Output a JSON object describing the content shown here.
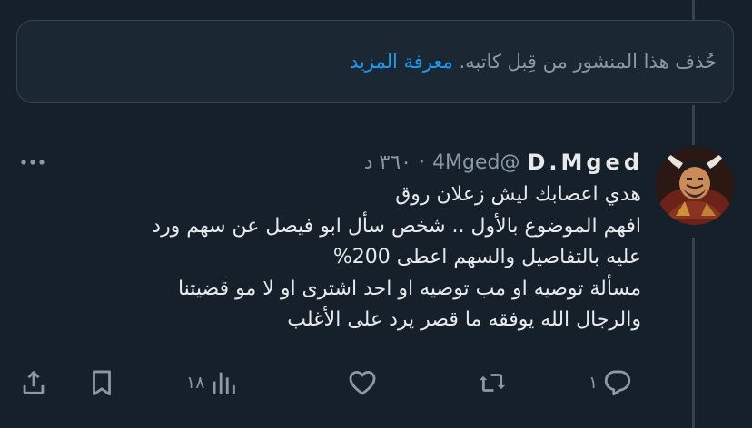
{
  "deleted_notice": {
    "text": "حُذف هذا المنشور من قِبل كاتبه.",
    "link": "معرفة المزيد"
  },
  "tweet": {
    "author": {
      "display_name": "D.Mged",
      "handle": "@4Mged"
    },
    "separator": "·",
    "timestamp": "٣٦٠ د",
    "lines": [
      "هدي اعصابك ليش زعلان روق",
      "افهم الموضوع بالأول .. شخص سأل ابو فيصل عن سهم ورد",
      "عليه بالتفاصيل والسهم اعطى 200%",
      "مسألة توصيه او مب توصيه او احد اشترى او لا مو قضيتنا",
      "والرجال الله يوفقه ما قصر يرد على الأغلب"
    ],
    "actions": {
      "reply_count": "١",
      "views_count": "١٨"
    }
  },
  "icons": {
    "more": "more-horizontal-icon",
    "reply": "reply-bubble-icon",
    "retweet": "retweet-icon",
    "like": "heart-icon",
    "views": "bar-chart-icon",
    "bookmark": "bookmark-icon",
    "share": "share-upload-icon"
  },
  "colors": {
    "background": "#15202b",
    "border": "#38444d",
    "text_primary": "#e7e9ea",
    "text_secondary": "#8b98a5",
    "link": "#1d9bf0"
  }
}
